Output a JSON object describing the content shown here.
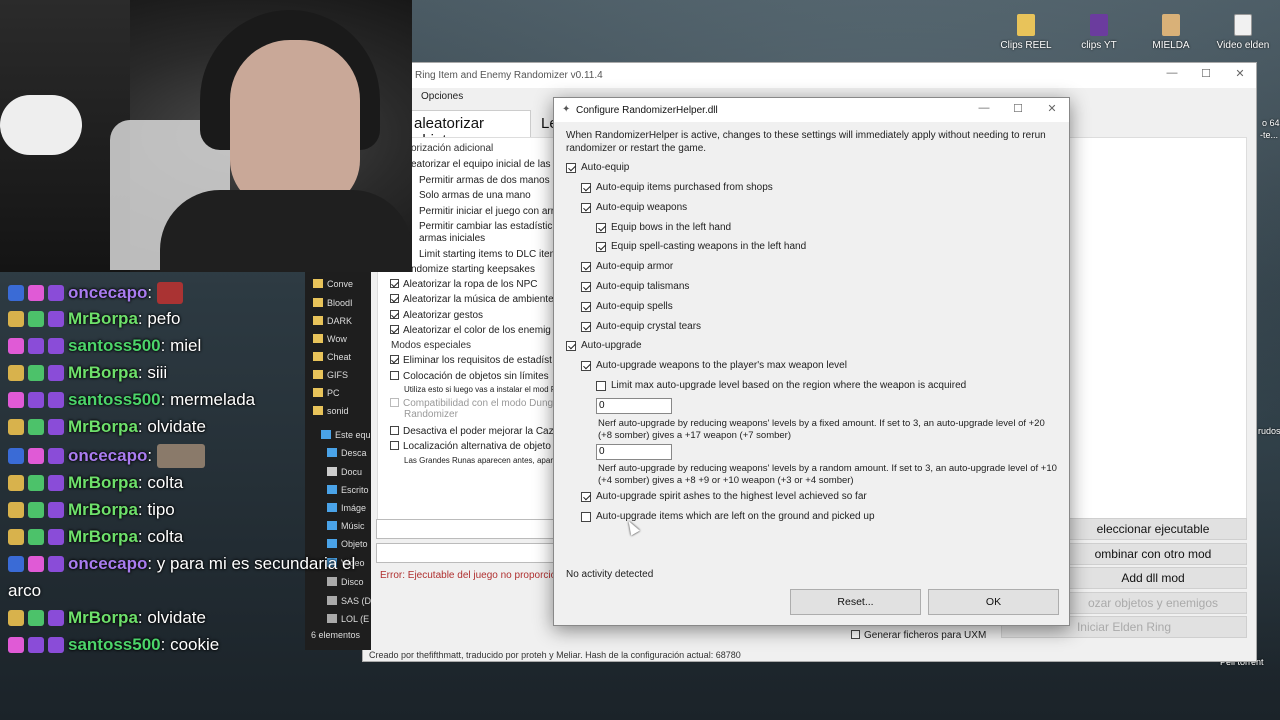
{
  "desktop": {
    "icons": [
      {
        "label": "Clips REEL",
        "icon": "folder-icon"
      },
      {
        "label": "clips YT",
        "icon": "media-file-icon"
      },
      {
        "label": "MIELDA",
        "icon": "document-icon"
      },
      {
        "label": "Video elden",
        "icon": "file-icon"
      }
    ],
    "edge_texts": [
      "o 64",
      "-te...",
      "rudos",
      "Peli torrent"
    ]
  },
  "chat": {
    "messages": [
      {
        "user": "oncecapo",
        "text": "",
        "badges": [
          "blue",
          "pink",
          "purple"
        ],
        "has_image": true
      },
      {
        "user": "MrBorpa",
        "text": ": pefo",
        "badges": [
          "yellow",
          "green",
          "purple"
        ]
      },
      {
        "user": "santoss500",
        "text": ": miel",
        "badges": [
          "pink",
          "purple",
          "purple"
        ]
      },
      {
        "user": "MrBorpa",
        "text": ": siii",
        "badges": [
          "yellow",
          "green",
          "purple"
        ]
      },
      {
        "user": "santoss500",
        "text": ": mermelada",
        "badges": [
          "pink",
          "purple",
          "purple"
        ]
      },
      {
        "user": "MrBorpa",
        "text": ": olvidate",
        "badges": [
          "yellow",
          "green",
          "purple"
        ]
      },
      {
        "user": "oncecapo",
        "text": "",
        "badges": [
          "blue",
          "pink",
          "purple"
        ],
        "has_image": true
      },
      {
        "user": "MrBorpa",
        "text": ": colta",
        "badges": [
          "yellow",
          "green",
          "purple"
        ]
      },
      {
        "user": "MrBorpa",
        "text": ": tipo",
        "badges": [
          "yellow",
          "green",
          "purple"
        ]
      },
      {
        "user": "MrBorpa",
        "text": ": colta",
        "badges": [
          "yellow",
          "green",
          "purple"
        ]
      },
      {
        "user": "oncecapo",
        "text": ": y para mi es secundaria el",
        "badges": [
          "blue",
          "pink",
          "purple"
        ]
      },
      {
        "user": "MrBorpa",
        "text": ": olvidate",
        "badges": [
          "yellow",
          "green",
          "purple"
        ]
      },
      {
        "user": "santoss500",
        "text": ": cookie",
        "badges": [
          "pink",
          "purple",
          "purple"
        ]
      }
    ],
    "wrap_text": "arco"
  },
  "explorer": {
    "items": [
      "Conve",
      "BloodI",
      "DARK",
      "Wow",
      "Cheat",
      "GIFS",
      "PC",
      "sonid",
      "Este equ",
      "Desca",
      "Docu",
      "Escrito",
      "Imáge",
      "Músic",
      "Objeto",
      "Vídeo",
      "Disco",
      "SAS (D",
      "LOL (E"
    ],
    "count": "6 elementos"
  },
  "main_window": {
    "title": "Ring Item and Enemy Randomizer v0.11.4",
    "menu": "Opciones",
    "tab_active": "aleatorizar objetos",
    "tab_other": "Le",
    "options": [
      {
        "label": "orización adicional",
        "section": true
      },
      {
        "label": "eatorizar el equipo inicial de las",
        "checked": null
      },
      {
        "label": "Permitir armas de dos manos",
        "checked": null
      },
      {
        "label": "Solo armas de una mano",
        "checked": null
      },
      {
        "label": "Permitir iniciar el juego con arr",
        "checked": null
      },
      {
        "label": "Permitir cambiar las estadístic",
        "checked": null
      },
      {
        "label": "armas iniciales",
        "checked": null
      },
      {
        "label": "Limit starting items to DLC item",
        "checked": null
      },
      {
        "label": "ndomize starting keepsakes",
        "checked": null
      },
      {
        "label": "Aleatorizar la ropa de los NPC",
        "checked": true
      },
      {
        "label": "Aleatorizar la música de ambiente",
        "checked": true
      },
      {
        "label": "Aleatorizar gestos",
        "checked": true
      },
      {
        "label": "Aleatorizar el color de los enemig",
        "checked": true
      },
      {
        "label": "Modos especiales",
        "section": true
      },
      {
        "label": "Eliminar los requisitos de estadíst",
        "checked": true
      },
      {
        "label": "Colocación de objetos sin límites",
        "checked": false
      },
      {
        "label": "Utiliza esto si luego vas a instalar el mod F",
        "tiny": true
      },
      {
        "label": "Compatibilidad con el modo Dung",
        "checked": false,
        "disabled": true
      },
      {
        "label": "Randomizer",
        "disabled": true
      },
      {
        "label": "Desactiva el poder mejorar la Caz",
        "checked": false
      },
      {
        "label": "Localización alternativa de objeto",
        "checked": false
      },
      {
        "label": "Las Grandes Runas aparecen antes, apar",
        "tiny": true
      }
    ],
    "error": "Error: Ejecutable del juego no proporcio",
    "buttons": [
      "eleccionar ejecutable",
      "ombinar con otro mod",
      "Add dll mod",
      "ozar objetos y enemigos",
      "Iniciar Elden Ring"
    ],
    "uxm_label": "Generar ficheros para UXM",
    "footer": "Creado por thefifthmatt, traducido por proteh y Meliar. Hash de la configuración actual: 68780"
  },
  "dialog": {
    "title": "Configure RandomizerHelper.dll",
    "description": "When RandomizerHelper is active, changes to these settings will immediately apply without needing to rerun randomizer or restart the game.",
    "options": [
      {
        "label": "Auto-equip",
        "checked": true,
        "level": 0
      },
      {
        "label": "Auto-equip items purchased from shops",
        "checked": true,
        "level": 1
      },
      {
        "label": "Auto-equip weapons",
        "checked": true,
        "level": 1
      },
      {
        "label": "Equip bows in the left hand",
        "checked": true,
        "level": 2
      },
      {
        "label": "Equip spell-casting weapons in the left hand",
        "checked": true,
        "level": 2
      },
      {
        "label": "Auto-equip armor",
        "checked": true,
        "level": 1
      },
      {
        "label": "Auto-equip talismans",
        "checked": true,
        "level": 1
      },
      {
        "label": "Auto-equip spells",
        "checked": true,
        "level": 1
      },
      {
        "label": "Auto-equip crystal tears",
        "checked": true,
        "level": 1
      },
      {
        "label": "Auto-upgrade",
        "checked": true,
        "level": 0
      },
      {
        "label": "Auto-upgrade weapons to the player's max weapon level",
        "checked": true,
        "level": 1
      },
      {
        "label": "Limit max auto-upgrade level based on the region where the weapon is acquired",
        "checked": false,
        "level": 2
      }
    ],
    "nerf_fixed_value": "0",
    "nerf_fixed_text": "Nerf auto-upgrade by reducing weapons' levels by a fixed amount. If set to 3, an auto-upgrade level of +20 (+8 somber) gives a +17 weapon (+7 somber)",
    "nerf_random_value": "0",
    "nerf_random_text": "Nerf auto-upgrade by reducing weapons' levels by a random amount. If set to 3, an auto-upgrade level of +10 (+4 somber) gives a +8 +9 or +10 weapon (+3 or +4 somber)",
    "spirit_label": "Auto-upgrade spirit ashes to the highest level achieved so far",
    "spirit_checked": true,
    "ground_label": "Auto-upgrade items which are left on the ground and picked up",
    "ground_checked": false,
    "status": "No activity detected",
    "reset_label": "Reset...",
    "ok_label": "OK"
  }
}
